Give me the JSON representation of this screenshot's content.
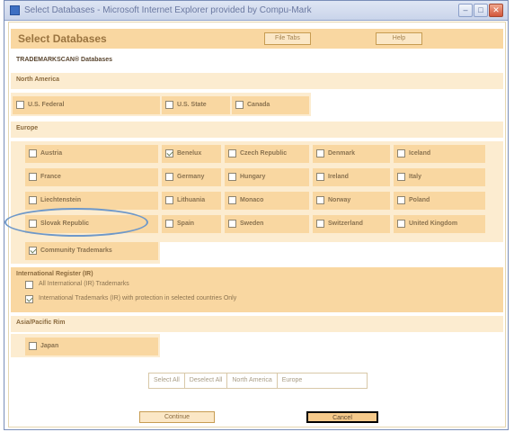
{
  "window": {
    "title": "Select Databases - Microsoft Internet Explorer provided by Compu-Mark",
    "minimize": "–",
    "maximize": "□",
    "close": "✕"
  },
  "header": {
    "title": "Select Databases",
    "file_tabs_label": "File Tabs",
    "help_label": "Help"
  },
  "db_label": "TRADEMARKSCAN® Databases",
  "sections": {
    "north_america": "North America",
    "europe": "Europe",
    "international": "International Register (IR)",
    "asia": "Asia/Pacific Rim"
  },
  "north_america": [
    {
      "label": "U.S. Federal",
      "checked": false
    },
    {
      "label": "U.S. State",
      "checked": false
    },
    {
      "label": "Canada",
      "checked": false
    }
  ],
  "europe": [
    {
      "label": "Austria",
      "checked": false
    },
    {
      "label": "Benelux",
      "checked": true
    },
    {
      "label": "Czech Republic",
      "checked": false
    },
    {
      "label": "Denmark",
      "checked": false
    },
    {
      "label": "Iceland",
      "checked": false
    },
    {
      "label": "France",
      "checked": false
    },
    {
      "label": "Germany",
      "checked": false
    },
    {
      "label": "Hungary",
      "checked": false
    },
    {
      "label": "Ireland",
      "checked": false
    },
    {
      "label": "Italy",
      "checked": false
    },
    {
      "label": "Liechtenstein",
      "checked": false
    },
    {
      "label": "Lithuania",
      "checked": false
    },
    {
      "label": "Monaco",
      "checked": false
    },
    {
      "label": "Norway",
      "checked": false
    },
    {
      "label": "Poland",
      "checked": false
    },
    {
      "label": "Slovak Republic",
      "checked": false
    },
    {
      "label": "Spain",
      "checked": false
    },
    {
      "label": "Sweden",
      "checked": false
    },
    {
      "label": "Switzerland",
      "checked": false
    },
    {
      "label": "United Kingdom",
      "checked": false
    }
  ],
  "community": {
    "label": "Community Trademarks",
    "checked": true
  },
  "international": [
    {
      "label": "All International (IR) Trademarks",
      "checked": false
    },
    {
      "label": "International Trademarks (IR) with protection in selected countries Only",
      "checked": true
    }
  ],
  "asia": [
    {
      "label": "Japan",
      "checked": false
    }
  ],
  "filters": [
    "Select All",
    "Deselect All",
    "North America",
    "Europe"
  ],
  "actions": {
    "continue": "Continue",
    "cancel": "Cancel"
  }
}
